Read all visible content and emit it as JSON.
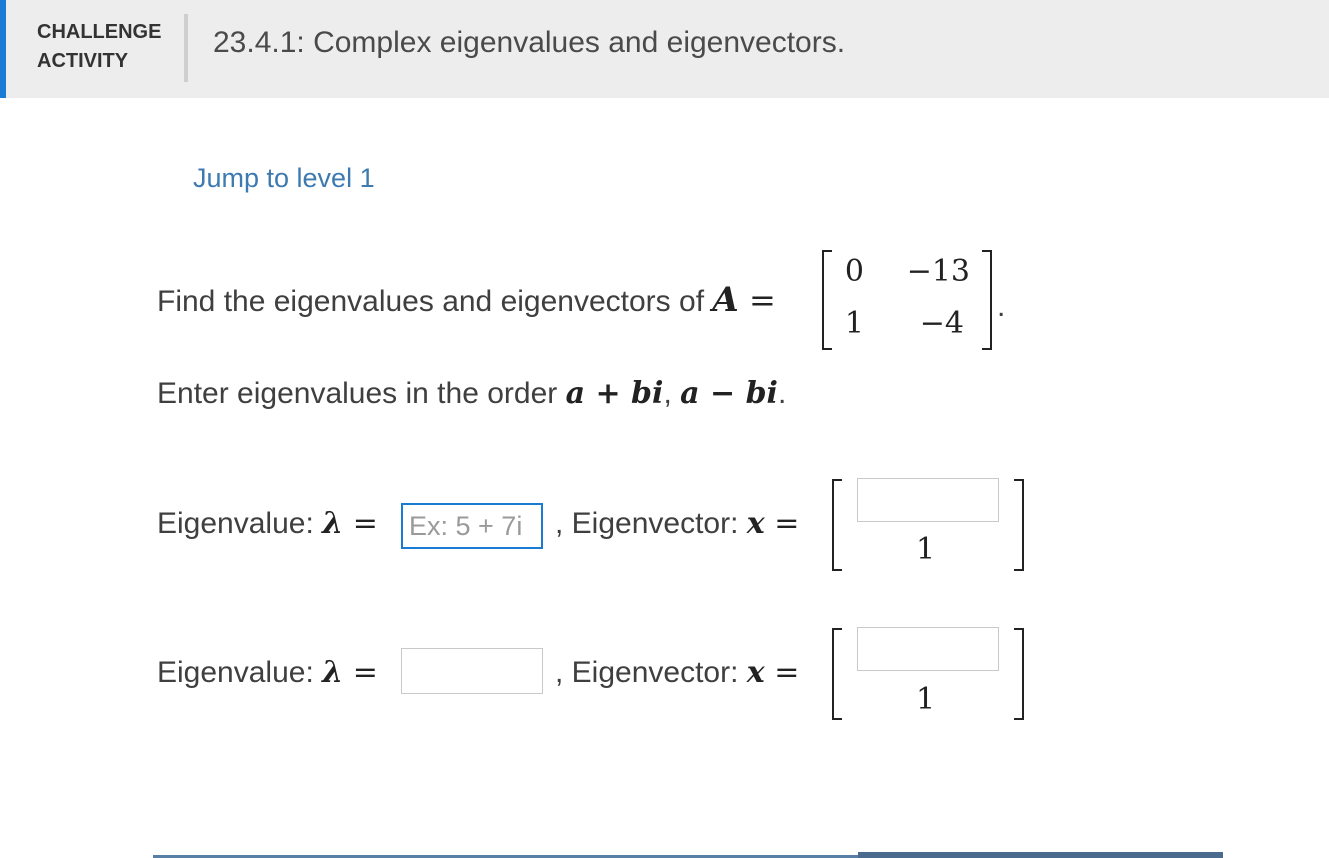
{
  "header": {
    "kind_line1": "CHALLENGE",
    "kind_line2": "ACTIVITY",
    "title": "23.4.1: Complex eigenvalues and eigenvectors.",
    "accent_color": "#1a7bd4"
  },
  "jump_link": "Jump to level 1",
  "problem": {
    "text": "Find the eigenvalues and eigenvectors of ",
    "var": "A",
    "eq": " = ",
    "matrix": [
      [
        "0",
        "−13"
      ],
      [
        "1",
        "−4"
      ]
    ],
    "period": "."
  },
  "order": {
    "text": "Enter eigenvalues in the order ",
    "expr1": "a + bi",
    "sep": ", ",
    "expr2": "a − bi",
    "period": "."
  },
  "rows": [
    {
      "eig_label": "Eigenvalue: ",
      "lambda": "λ",
      "eq": " =",
      "eig_value": "",
      "eig_placeholder": "Ex: 5 + 7i",
      "vec_label": ", Eigenvector: ",
      "x": "x",
      "vec_eq": " =",
      "vec_top_value": "",
      "vec_bottom": "1"
    },
    {
      "eig_label": "Eigenvalue: ",
      "lambda": "λ",
      "eq": " =",
      "eig_value": "",
      "eig_placeholder": "",
      "vec_label": ", Eigenvector: ",
      "x": "x",
      "vec_eq": " =",
      "vec_top_value": "",
      "vec_bottom": "1"
    }
  ]
}
